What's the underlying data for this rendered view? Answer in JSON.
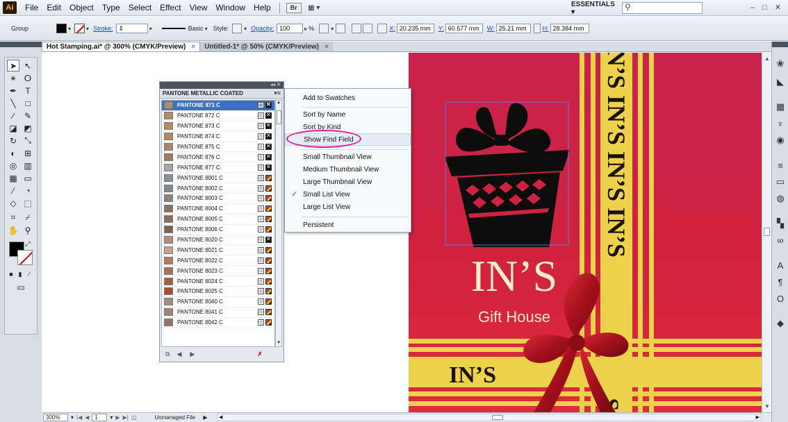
{
  "app": {
    "logo": "Ai",
    "menu": [
      "File",
      "Edit",
      "Object",
      "Type",
      "Select",
      "Effect",
      "View",
      "Window",
      "Help"
    ],
    "bridge_label": "Br",
    "arrange_label": "▦ ▾",
    "workspace": "ESSENTIALS ▾",
    "search_icon": "⚲",
    "window_controls": "– □ ✕"
  },
  "control_bar": {
    "selection_label": "Group",
    "stroke_label": "Stroke:",
    "brush_label": "Basic",
    "style_label": "Style:",
    "opacity_label": "Opacity:",
    "opacity_value": "100",
    "opacity_unit": "%",
    "x_label": "X:",
    "x_value": "20.235 mm",
    "y_label": "Y:",
    "y_value": "60.577 mm",
    "w_label": "W:",
    "w_value": "25.21 mm",
    "h_label": "H:",
    "h_value": "28.384 mm"
  },
  "tabs": [
    {
      "label": "Hot Stamping.ai* @ 300% (CMYK/Preview)",
      "close": "×"
    },
    {
      "label": "Untitled-1* @ 50% (CMYK/Preview)",
      "close": "×"
    }
  ],
  "swatches_panel": {
    "title": "PANTONE METALLIC COATED",
    "menu_icon": "▾≡",
    "collapse": "◂◂ ✕",
    "rows": [
      {
        "name": "PANTONE 871 C",
        "color": "#a8906b",
        "selected": true
      },
      {
        "name": "PANTONE 872 C",
        "color": "#b18f62"
      },
      {
        "name": "PANTONE 873 C",
        "color": "#b38d66"
      },
      {
        "name": "PANTONE 874 C",
        "color": "#b08c5c"
      },
      {
        "name": "PANTONE 875 C",
        "color": "#a68a68"
      },
      {
        "name": "PANTONE 876 C",
        "color": "#a0785c"
      },
      {
        "name": "PANTONE 877 C",
        "color": "#a5a7a9"
      },
      {
        "name": "PANTONE 8001 C",
        "color": "#8d9096"
      },
      {
        "name": "PANTONE 8002 C",
        "color": "#868a8b"
      },
      {
        "name": "PANTONE 8003 C",
        "color": "#8b8378"
      },
      {
        "name": "PANTONE 8004 C",
        "color": "#857463"
      },
      {
        "name": "PANTONE 8005 C",
        "color": "#8a6e5a"
      },
      {
        "name": "PANTONE 8006 C",
        "color": "#7c6652"
      },
      {
        "name": "PANTONE 8020 C",
        "color": "#b8897d"
      },
      {
        "name": "PANTONE 8021 C",
        "color": "#c8a58a"
      },
      {
        "name": "PANTONE 8022 C",
        "color": "#b87c5d"
      },
      {
        "name": "PANTONE 8023 C",
        "color": "#b06f52"
      },
      {
        "name": "PANTONE 8024 C",
        "color": "#a65c3c"
      },
      {
        "name": "PANTONE 8025 C",
        "color": "#a84d2b"
      },
      {
        "name": "PANTONE 8040 C",
        "color": "#a58d86"
      },
      {
        "name": "PANTONE 8041 C",
        "color": "#9e8378"
      },
      {
        "name": "PANTONE 8042 C",
        "color": "#8f7a70"
      }
    ]
  },
  "context_menu": {
    "items": [
      {
        "label": "Add to Swatches"
      },
      {
        "label": "Sort by Name"
      },
      {
        "label": "Sort by Kind"
      },
      {
        "label": "Show Find Field",
        "highlighted": true
      },
      {
        "label": "Small Thumbnail View"
      },
      {
        "label": "Medium Thumbnail View"
      },
      {
        "label": "Large Thumbnail View"
      },
      {
        "label": "Small List View",
        "checked": true
      },
      {
        "label": "Large List View"
      },
      {
        "label": "Persistent"
      }
    ]
  },
  "artboard": {
    "brand": "IN’S",
    "subtitle": "Gift House",
    "band_text": "IN’S IN’S IN’S IN’S",
    "bottom_text": "IN’S",
    "bottom_partial": "S",
    "colors": {
      "background": "#cf2142",
      "gold": "#ecd24a",
      "ink": "#1a1006",
      "cream": "#f3eccd",
      "ribbon": "#a4101b"
    }
  },
  "status_bar": {
    "zoom": "300%",
    "page": "1",
    "file_status": "Unmanaged File"
  }
}
